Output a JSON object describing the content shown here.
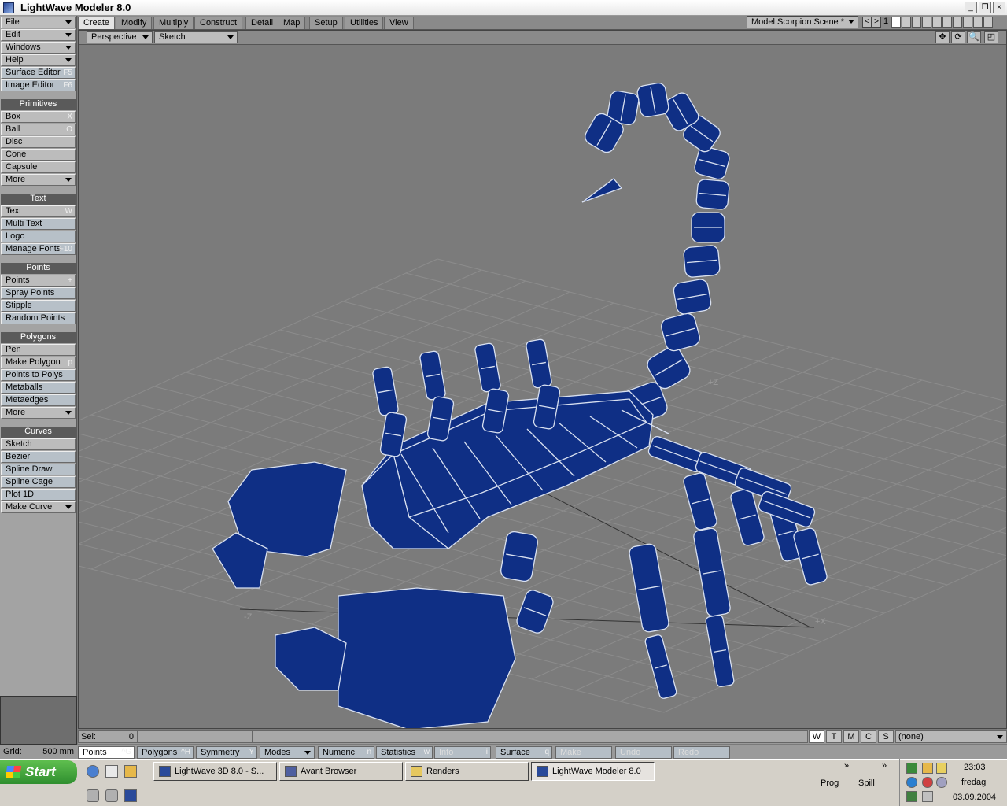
{
  "window": {
    "title": "LightWave Modeler 8.0"
  },
  "left_menus": [
    "File",
    "Edit",
    "Windows",
    "Help"
  ],
  "left_quick": [
    {
      "label": "Surface Editor",
      "shortcut": "F5"
    },
    {
      "label": "Image Editor",
      "shortcut": "F6"
    }
  ],
  "sections": {
    "primitives": {
      "title": "Primitives",
      "items": [
        {
          "label": "Box",
          "sc": "X"
        },
        {
          "label": "Ball",
          "sc": "O"
        },
        {
          "label": "Disc",
          "sc": ""
        },
        {
          "label": "Cone",
          "sc": ""
        },
        {
          "label": "Capsule",
          "sc": ""
        },
        {
          "label": "More",
          "sc": ""
        }
      ]
    },
    "text": {
      "title": "Text",
      "items": [
        {
          "label": "Text",
          "sc": "W"
        },
        {
          "label": "Multi Text",
          "sc": ""
        },
        {
          "label": "Logo",
          "sc": ""
        },
        {
          "label": "Manage Fonts",
          "sc": "F10"
        }
      ]
    },
    "points": {
      "title": "Points",
      "items": [
        {
          "label": "Points",
          "sc": "+"
        },
        {
          "label": "Spray Points",
          "sc": ""
        },
        {
          "label": "Stipple",
          "sc": ""
        },
        {
          "label": "Random Points",
          "sc": ""
        }
      ]
    },
    "polygons": {
      "title": "Polygons",
      "items": [
        {
          "label": "Pen",
          "sc": ""
        },
        {
          "label": "Make Polygon",
          "sc": "p"
        },
        {
          "label": "Points to Polys",
          "sc": ""
        },
        {
          "label": "Metaballs",
          "sc": ""
        },
        {
          "label": "Metaedges",
          "sc": ""
        },
        {
          "label": "More",
          "sc": ""
        }
      ]
    },
    "curves": {
      "title": "Curves",
      "items": [
        {
          "label": "Sketch",
          "sc": ""
        },
        {
          "label": "Bezier",
          "sc": ""
        },
        {
          "label": "Spline Draw",
          "sc": ""
        },
        {
          "label": "Spline Cage",
          "sc": ""
        },
        {
          "label": "Plot 1D",
          "sc": ""
        },
        {
          "label": "Make Curve",
          "sc": ""
        }
      ]
    }
  },
  "tabs": [
    "Create",
    "Modify",
    "Multiply",
    "Construct",
    "Detail",
    "Map",
    "Setup",
    "Utilities",
    "View"
  ],
  "scene_select": "Model Scorpion Scene *",
  "layer_number": "1",
  "viewport": {
    "view_type": "Perspective",
    "render_mode": "Sketch",
    "axis_x_label": "+X",
    "axis_z_label": "+Z",
    "axis_z_neg_label": "-Z"
  },
  "status": {
    "sel_label": "Sel:",
    "sel_value": "0",
    "grid_label": "Grid:",
    "grid_value": "500 mm",
    "wtmcs": [
      "W",
      "T",
      "M",
      "C",
      "S"
    ],
    "surface_value": "(none)"
  },
  "modebar": [
    {
      "label": "Points",
      "sc": "^G",
      "active": true
    },
    {
      "label": "Polygons",
      "sc": "^H"
    },
    {
      "label": "Symmetry",
      "sc": "Y"
    },
    {
      "label": "Modes",
      "sc": ""
    },
    {
      "label": "Numeric",
      "sc": "n"
    },
    {
      "label": "Statistics",
      "sc": "w"
    },
    {
      "label": "Info",
      "sc": "i",
      "disabled": true
    },
    {
      "label": "Surface",
      "sc": "q"
    },
    {
      "label": "Make",
      "sc": "",
      "disabled": true
    },
    {
      "label": "Undo",
      "sc": "",
      "disabled": true
    },
    {
      "label": "Redo",
      "sc": "",
      "disabled": true
    }
  ],
  "taskbar": {
    "start": "Start",
    "tasks": [
      "LightWave 3D 8.0 - S...",
      "Avant Browser",
      "Renders",
      "LightWave Modeler 8.0"
    ],
    "prog": "Prog",
    "spill": "Spill",
    "time": "23:03",
    "day": "fredag",
    "date": "03.09.2004"
  },
  "colors": {
    "mesh_fill": "#0f2f85",
    "wire": "#d8e0f0",
    "grid": "#8a8a8a"
  }
}
